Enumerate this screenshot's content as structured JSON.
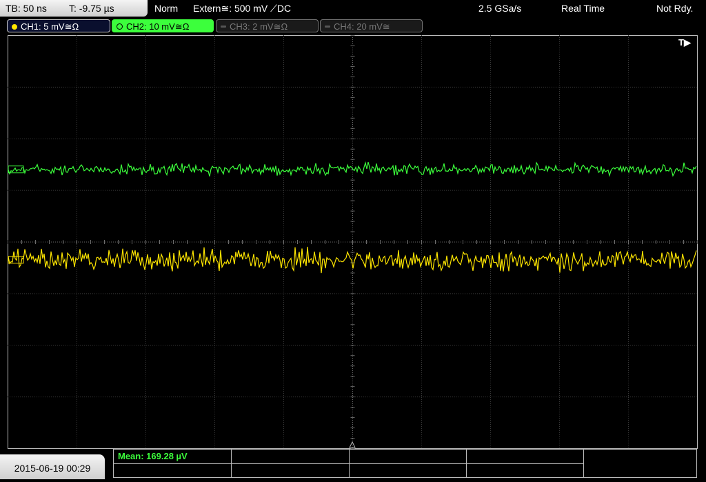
{
  "header": {
    "timebase": "TB: 50 ns",
    "trigger_time": "T: -9.75 µs",
    "trigger_mode": "Norm",
    "trigger_source": "Extern≅: 500 mV ⟋DC",
    "sample_rate": "2.5 GSa/s",
    "acq_mode": "Real Time",
    "status": "Not Rdy."
  },
  "channels": [
    {
      "label": "CH1: 5 mV≅Ω",
      "color": "#ffe600",
      "active": true
    },
    {
      "label": "CH2: 10 mV≅Ω",
      "color": "#3cff3c",
      "active": true
    },
    {
      "label": "CH3: 2 mV≅Ω",
      "color": "#777777",
      "active": false
    },
    {
      "label": "CH4: 20 mV≅",
      "color": "#777777",
      "active": false
    }
  ],
  "trigger_marker": "T▶",
  "traces": {
    "ch2_level_div": 2.6,
    "ch1_level_div": 4.35,
    "ch2_noise_div": 0.05,
    "ch1_noise_div": 0.1
  },
  "footer": {
    "datetime": "2015-06-19 00:29",
    "measurement": "Mean: 169.28 µV"
  }
}
